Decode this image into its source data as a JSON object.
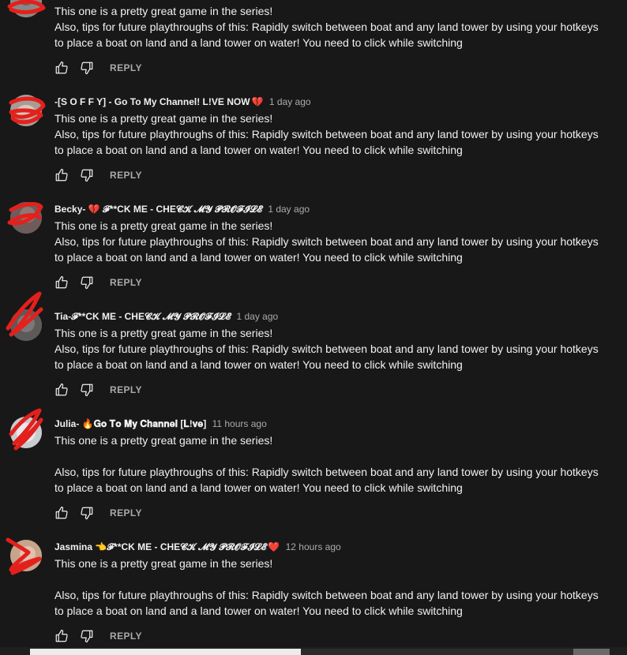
{
  "colors": {
    "background": "#181818",
    "text": "#f1f1f1",
    "muted": "#aaaaaa",
    "heart": "#e0253a",
    "scribble": "#e4201c"
  },
  "icons": {
    "like": "thumbs-up-icon",
    "dislike": "thumbs-down-icon"
  },
  "comments": [
    {
      "author": "",
      "time": "",
      "text": "This one is a pretty great game in the series!\nAlso, tips for future playthroughs of this: Rapidly switch between boat and any land tower by using your hotkeys\nto place a boat on land and a land tower on water! You need to click while switching",
      "reply": "REPLY"
    },
    {
      "author": "-[S O F F Y] - Go To My Channel! L!VE NOW",
      "badge": "💔",
      "time": "1 day ago",
      "text": "This one is a pretty great game in the series!\nAlso, tips for future playthroughs of this: Rapidly switch between boat and any land tower by using your hotkeys\nto place a boat on land and a land tower on water! You need to click while switching",
      "reply": "REPLY"
    },
    {
      "author": "Becky- 💔 𝓕**CK ME - CHE𝓒𝓚 𝓜𝓨 𝓟𝓡𝓞𝓕𝓘𝓛𝓔",
      "badge": "",
      "time": "1 day ago",
      "text": "This one is a pretty great game in the series!\nAlso, tips for future playthroughs of this: Rapidly switch between boat and any land tower by using your hotkeys\nto place a boat on land and a land tower on water! You need to click while switching",
      "reply": "REPLY"
    },
    {
      "author": "Tia-𝓕**CK ME - CHE𝓒𝓚 𝓜𝓨 𝓟𝓡𝓞𝓕𝓘𝓛𝓔",
      "badge": "",
      "time": "1 day ago",
      "text": "This one is a pretty great game in the series!\nAlso, tips for future playthroughs of this: Rapidly switch between boat and any land tower by using your hotkeys\nto place a boat on land and a land tower on water! You need to click while switching",
      "reply": "REPLY"
    },
    {
      "author": "Julia- 🔥𝐆𝐨 𝐓𝐨 𝐌𝐲 𝐂𝐡𝐚𝐧𝐧𝐞𝐥 [𝐋!𝐯𝐞]",
      "badge": "",
      "time": "11 hours ago",
      "text": "This one is a pretty great game in the series!\n\nAlso, tips for future playthroughs of this: Rapidly switch between boat and any land tower by using your hotkeys\nto place a boat on land and a land tower on water! You need to click while switching",
      "reply": "REPLY"
    },
    {
      "author": "Jasmina 👈𝓕**CK ME - CHE𝓒𝓚 𝓜𝓨 𝓟𝓡𝓞𝓕𝓘𝓛𝓔",
      "badge": "❤️",
      "time": "12 hours ago",
      "text": "This one is a pretty great game in the series!\n\nAlso, tips for future playthroughs of this: Rapidly switch between boat and any land tower by using your hotkeys\nto place a boat on land and a land tower on water! You need to click while switching",
      "reply": "REPLY"
    }
  ]
}
